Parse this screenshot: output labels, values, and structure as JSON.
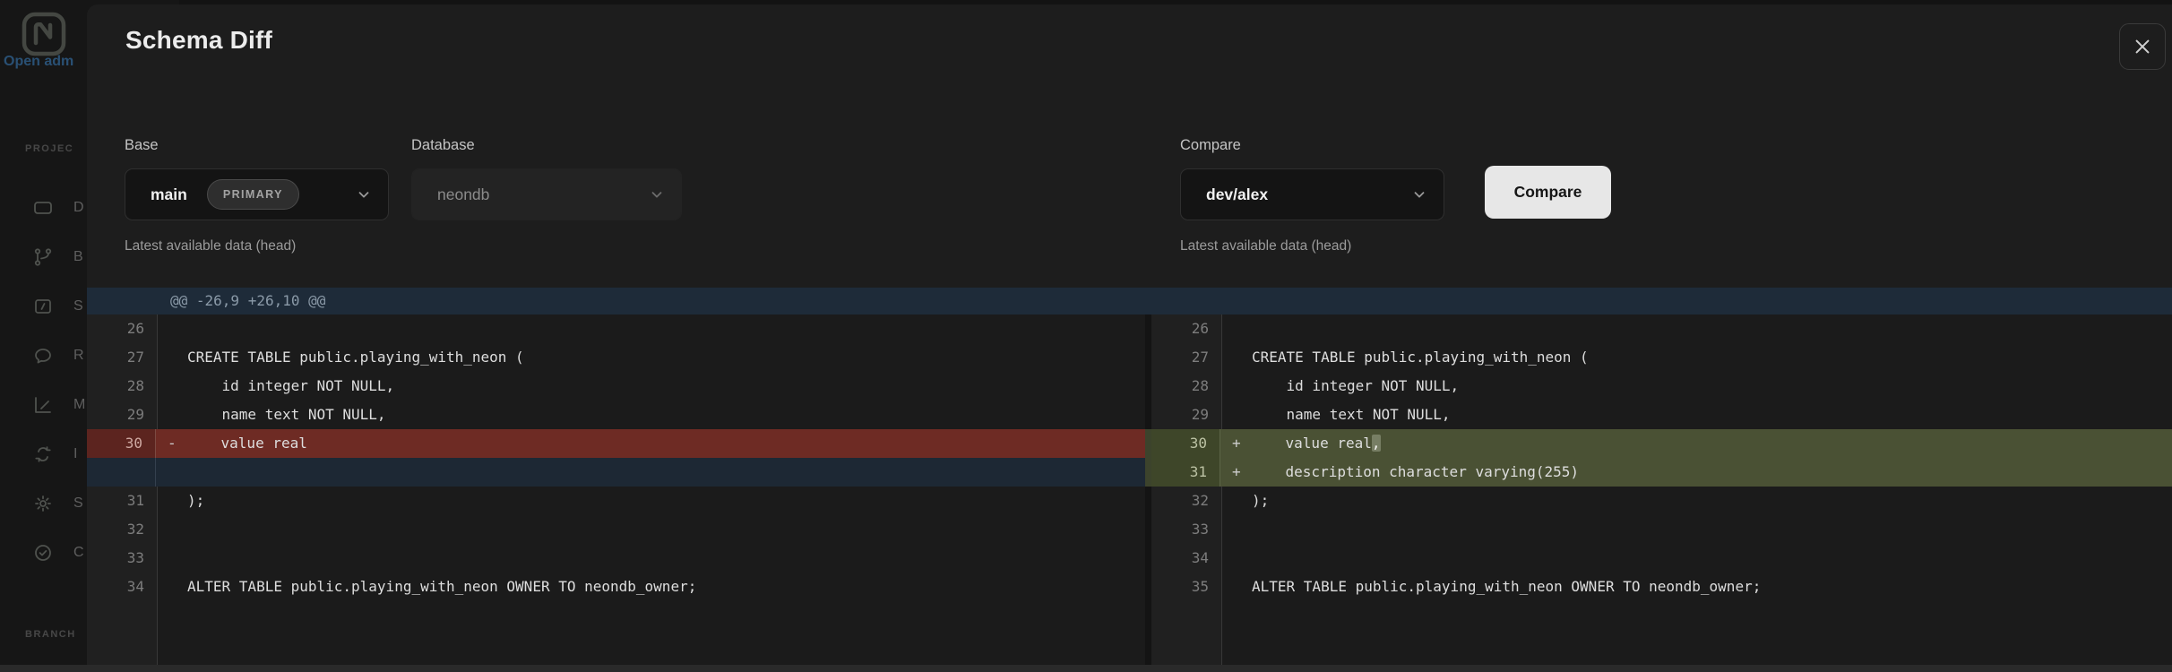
{
  "colors": {
    "accent_link_blue": "#3a80c2",
    "removed_row_bg": "#6e2b24",
    "added_row_bg": "#4a5134",
    "hunk_band_bg": "#1e2b39",
    "compare_button_bg": "#e7e7e7",
    "modal_bg": "#1d1d1d"
  },
  "sidebar": {
    "logo_icon": "neon-logo",
    "open_link": "Open adm",
    "projects_label": "PROJEC",
    "branches_label": "BRANCH",
    "items": [
      {
        "id": "d",
        "icon": "dashboard-icon",
        "label": "D"
      },
      {
        "id": "b",
        "icon": "branch-icon",
        "label": "B"
      },
      {
        "id": "s",
        "icon": "sql-editor-icon",
        "label": "S"
      },
      {
        "id": "r",
        "icon": "chat-icon",
        "label": "R"
      },
      {
        "id": "m",
        "icon": "monitoring-icon",
        "label": "M"
      },
      {
        "id": "i",
        "icon": "integrations-icon",
        "label": "I"
      },
      {
        "id": "se",
        "icon": "settings-icon",
        "label": "S"
      },
      {
        "id": "c",
        "icon": "check-circle-icon",
        "label": "C"
      }
    ]
  },
  "modal": {
    "title": "Schema Diff",
    "form": {
      "base": {
        "label": "Base",
        "value": "main",
        "badge": "PRIMARY",
        "hint": "Latest available data (head)"
      },
      "database": {
        "label": "Database",
        "value": "neondb"
      },
      "compare": {
        "label": "Compare",
        "value": "dev/alex",
        "hint": "Latest available data (head)"
      },
      "compare_button": "Compare"
    },
    "diff": {
      "hunk_header": "@@ -26,9 +26,10 @@",
      "left": {
        "rows": [
          {
            "num": 26,
            "text": ""
          },
          {
            "num": 27,
            "text": "CREATE TABLE public.playing_with_neon ("
          },
          {
            "num": 28,
            "text": "    id integer NOT NULL,"
          },
          {
            "num": 29,
            "text": "    name text NOT NULL,"
          },
          {
            "num": 30,
            "marker": "-",
            "type": "removed",
            "text": "    value real"
          },
          {
            "type": "filler",
            "text": ""
          },
          {
            "num": 31,
            "text": ");"
          },
          {
            "num": 32,
            "text": ""
          },
          {
            "num": 33,
            "text": ""
          },
          {
            "num": 34,
            "text": "ALTER TABLE public.playing_with_neon OWNER TO neondb_owner;"
          }
        ]
      },
      "right": {
        "rows": [
          {
            "num": 26,
            "text": ""
          },
          {
            "num": 27,
            "text": "CREATE TABLE public.playing_with_neon ("
          },
          {
            "num": 28,
            "text": "    id integer NOT NULL,"
          },
          {
            "num": 29,
            "text": "    name text NOT NULL,"
          },
          {
            "num": 30,
            "marker": "+",
            "type": "added",
            "text": "    value real",
            "hl": ","
          },
          {
            "num": 31,
            "marker": "+",
            "type": "added",
            "text": "    description character varying(255)"
          },
          {
            "num": 32,
            "text": ");"
          },
          {
            "num": 33,
            "text": ""
          },
          {
            "num": 34,
            "text": ""
          },
          {
            "num": 35,
            "text": "ALTER TABLE public.playing_with_neon OWNER TO neondb_owner;"
          }
        ]
      }
    }
  }
}
